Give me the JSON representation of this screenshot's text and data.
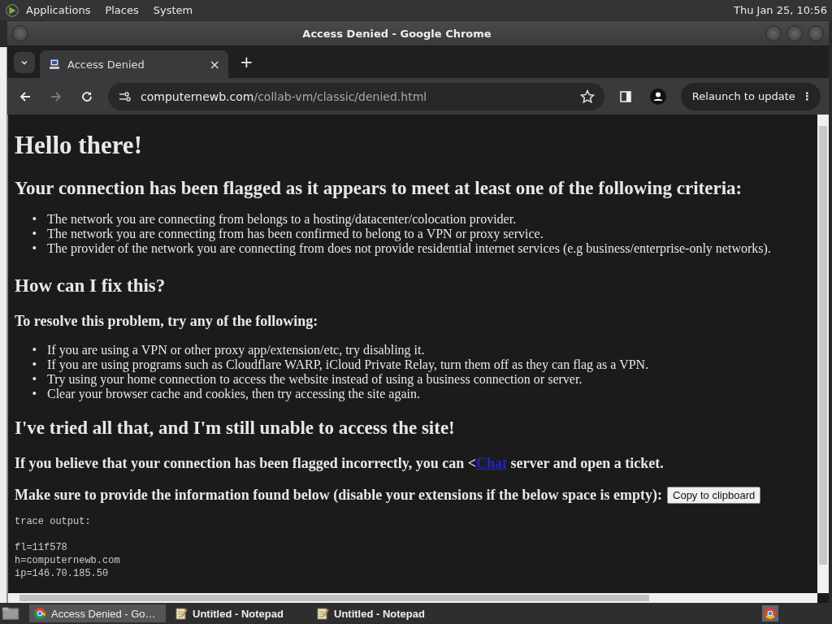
{
  "top_panel": {
    "menus": [
      "Applications",
      "Places",
      "System"
    ],
    "clock": "Thu Jan 25, 10:56"
  },
  "window": {
    "title": "Access Denied - Google Chrome"
  },
  "tabs": [
    {
      "label": "Access Denied",
      "selected": true,
      "close": "×"
    }
  ],
  "new_tab": "+",
  "toolbar": {
    "url_host": "computernewb.com",
    "url_path": "/collab-vm/classic/denied.html",
    "relaunch": "Relaunch to update",
    "menu": "⋮"
  },
  "page": {
    "title": "Hello there!",
    "heading_1": "Your connection has been flagged as it appears to meet at least one of the following criteria:",
    "criteria": [
      "The network you are connecting from belongs to a hosting/datacenter/colocation provider.",
      "The network you are connecting from has been confirmed to belong to a VPN or proxy service.",
      "The provider of the network you are connecting from does not provide residential internet services (e.g business/enterprise-only networks)."
    ],
    "heading_2": "How can I fix this?",
    "subheading": "To resolve this problem, try any of the following:",
    "fixes": [
      "If you are using a VPN or other proxy app/extension/etc, try disabling it.",
      "If you are using programs such as Cloudflare WARP, iCloud Private Relay, turn them off as they can flag as a VPN.",
      "Try using your home connection to access the website instead of using a business connection or server.",
      "Clear your browser cache and cookies, then try accessing the site again."
    ],
    "heading_3": "I've tried all that, and I'm still unable to access the site!",
    "ticket_before": "If you believe that your connection has been flagged incorrectly, you can <",
    "ticket_link": "Chat",
    "ticket_after": " server and open a ticket.",
    "info_text": "Make sure to provide the information found below (disable your extensions if the below space is empty):",
    "copy_button": "Copy to clipboard",
    "trace_heading": "trace output:",
    "trace": [
      "fl=11f578",
      "h=computernewb.com",
      "ip=146.70.185.50"
    ],
    "list_marker": "•"
  },
  "taskbar": [
    {
      "label": "Access Denied - Go…",
      "kind": "chrome",
      "selected": true
    },
    {
      "label": "Untitled - Notepad",
      "kind": "notepad",
      "selected": false
    },
    {
      "label": "Untitled - Notepad",
      "kind": "notepad",
      "selected": false
    }
  ]
}
